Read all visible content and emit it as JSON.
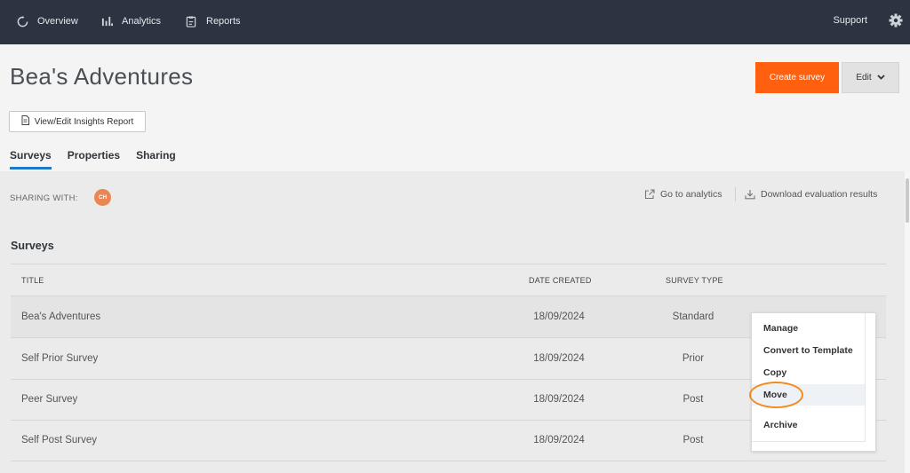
{
  "nav": {
    "items": [
      {
        "label": "Overview",
        "icon": "overview-icon"
      },
      {
        "label": "Analytics",
        "icon": "analytics-icon"
      },
      {
        "label": "Reports",
        "icon": "reports-icon"
      }
    ],
    "support": "Support",
    "settings_icon": "gear-icon"
  },
  "header": {
    "title": "Bea's Adventures",
    "create_label": "Create survey",
    "edit_label": "Edit",
    "insights_label": "View/Edit Insights Report"
  },
  "tabs": [
    {
      "label": "Surveys",
      "active": true
    },
    {
      "label": "Properties",
      "active": false
    },
    {
      "label": "Sharing",
      "active": false
    }
  ],
  "sharing": {
    "label": "SHARING WITH:",
    "avatar_initials": "CH",
    "avatar_color": "#e98754"
  },
  "links": {
    "analytics": "Go to analytics",
    "download": "Download evaluation results"
  },
  "surveys": {
    "title": "Surveys",
    "columns": [
      "TITLE",
      "DATE CREATED",
      "SURVEY TYPE"
    ],
    "rows": [
      {
        "title": "Bea's Adventures",
        "date": "18/09/2024",
        "type": "Standard"
      },
      {
        "title": "Self Prior Survey",
        "date": "18/09/2024",
        "type": "Prior"
      },
      {
        "title": "Peer Survey",
        "date": "18/09/2024",
        "type": "Post"
      },
      {
        "title": "Self Post Survey",
        "date": "18/09/2024",
        "type": "Post"
      }
    ]
  },
  "menu": {
    "items": [
      "Manage",
      "Convert to Template",
      "Copy",
      "Move",
      "Archive"
    ],
    "highlighted": "Move"
  },
  "colors": {
    "nav_bg": "#2b3440",
    "accent": "#ff6010",
    "tab_underline": "#1f78c8",
    "highlight_ring": "#f18c1c"
  }
}
